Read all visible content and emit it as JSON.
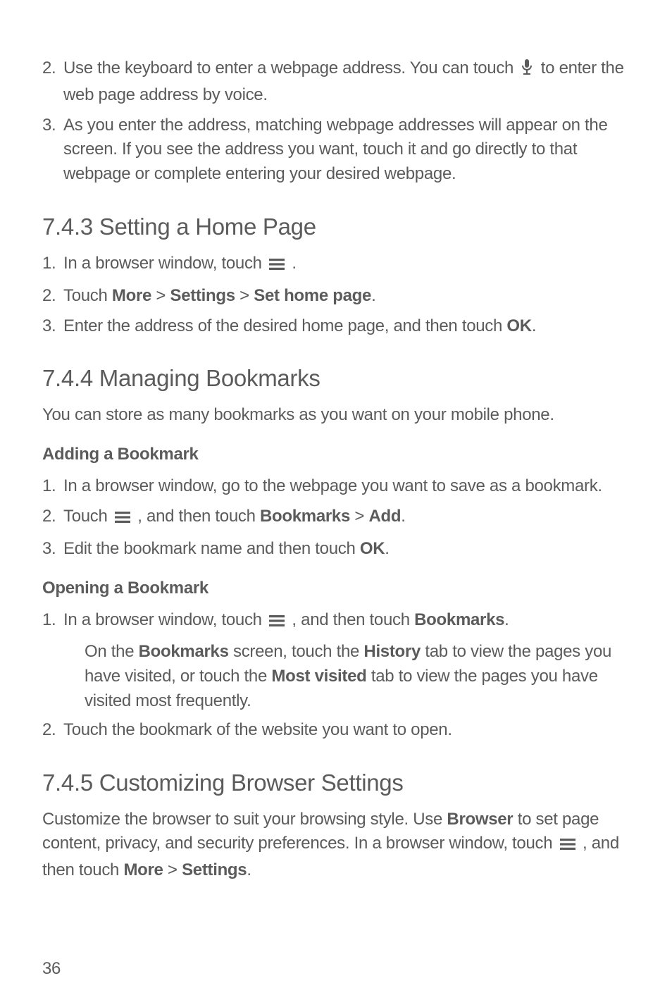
{
  "top_steps": [
    {
      "num": "2.",
      "parts": [
        "Use the keyboard to enter a webpage address. You can touch ",
        "ICON_MIC",
        " to enter the web page address by voice."
      ]
    },
    {
      "num": "3.",
      "parts": [
        "As you enter the address, matching webpage addresses will appear on the screen. If you see the address you want, touch it and go directly to that webpage or complete entering your desired webpage."
      ]
    }
  ],
  "sec743_title": "7.4.3  Setting a Home Page",
  "sec743_steps": [
    {
      "num": "1.",
      "parts": [
        "In a browser window, touch ",
        "ICON_MENU",
        " ."
      ]
    },
    {
      "num": "2.",
      "parts": [
        "Touch ",
        "BOLD:More",
        " > ",
        "BOLD:Settings",
        " > ",
        "BOLD:Set home page",
        "."
      ]
    },
    {
      "num": "3.",
      "parts": [
        "Enter the address of the desired home page, and then touch ",
        "BOLD:OK",
        "."
      ]
    }
  ],
  "sec744_title": "7.4.4  Managing Bookmarks",
  "sec744_intro": "You can store as many bookmarks as you want on your mobile phone.",
  "sec744_h1": "Adding a Bookmark",
  "sec744_h1_steps": [
    {
      "num": "1.",
      "parts": [
        "In a browser window, go to the webpage you want to save as a bookmark."
      ]
    },
    {
      "num": "2.",
      "parts": [
        "Touch ",
        "ICON_MENU",
        " , and then touch ",
        "BOLD:Bookmarks",
        " > ",
        "BOLD:Add",
        "."
      ]
    },
    {
      "num": "3.",
      "parts": [
        "Edit the bookmark name and then touch ",
        "BOLD:OK",
        "."
      ]
    }
  ],
  "sec744_h2": "Opening a Bookmark",
  "sec744_h2_steps": [
    {
      "num": "1.",
      "parts": [
        "In a browser window, touch ",
        "ICON_MENU",
        " , and then touch ",
        "BOLD:Bookmarks",
        "."
      ]
    }
  ],
  "sec744_h2_note_parts": [
    "On the ",
    "BOLD:Bookmarks",
    " screen, touch the ",
    "BOLD:History",
    " tab to view the pages you have visited, or touch the ",
    "BOLD:Most visited",
    " tab to view the pages you have visited most frequently."
  ],
  "sec744_h2_steps2": [
    {
      "num": "2.",
      "parts": [
        "Touch the bookmark of the website you want to open."
      ]
    }
  ],
  "sec745_title": "7.4.5  Customizing Browser Settings",
  "sec745_para_parts": [
    "Customize the browser to suit your browsing style. Use ",
    "BOLD:Browser",
    " to set page content, privacy, and security preferences. In a browser window, touch ",
    "ICON_MENU",
    " , and then touch ",
    "BOLD:More",
    " > ",
    "BOLD:Settings",
    "."
  ],
  "page_number": "36"
}
